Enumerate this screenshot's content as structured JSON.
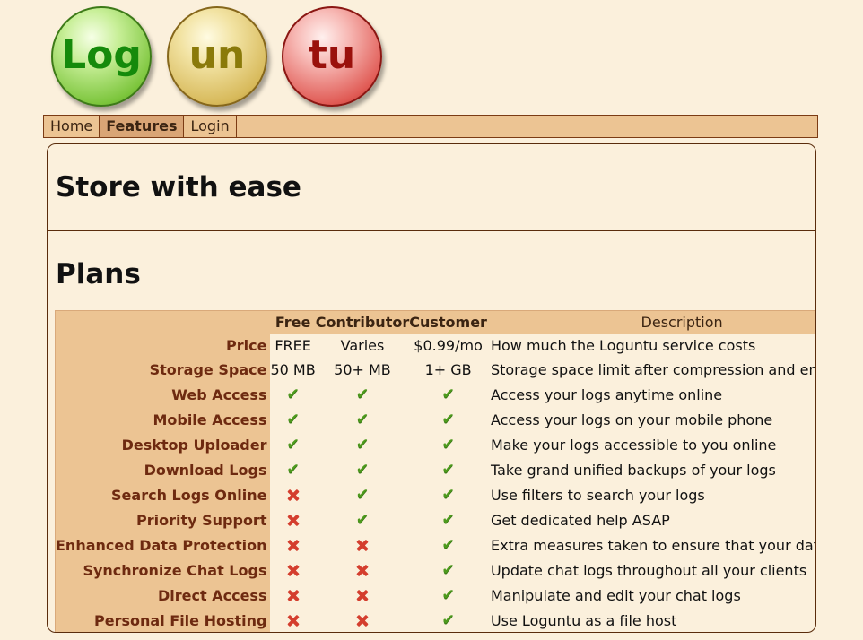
{
  "logo": [
    "Log",
    "un",
    "tu"
  ],
  "nav": [
    {
      "label": "Home",
      "active": false
    },
    {
      "label": "Features",
      "active": true
    },
    {
      "label": "Login",
      "active": false
    }
  ],
  "headings": {
    "store": "Store with ease",
    "plans": "Plans"
  },
  "table": {
    "headers": [
      "Free",
      "Contributor",
      "Customer",
      "Description"
    ],
    "rows": [
      {
        "feature": "Price",
        "free": "FREE",
        "contributor": "Varies",
        "customer": "$0.99/mo",
        "description": "How much the Loguntu service costs"
      },
      {
        "feature": "Storage Space",
        "free": "50 MB",
        "contributor": "50+ MB",
        "customer": "1+ GB",
        "description": "Storage space limit after compression and encryption"
      },
      {
        "feature": "Web Access",
        "free": "check",
        "contributor": "check",
        "customer": "check",
        "description": "Access your logs anytime online"
      },
      {
        "feature": "Mobile Access",
        "free": "check",
        "contributor": "check",
        "customer": "check",
        "description": "Access your logs on your mobile phone"
      },
      {
        "feature": "Desktop Uploader",
        "free": "check",
        "contributor": "check",
        "customer": "check",
        "description": "Make your logs accessible to you online"
      },
      {
        "feature": "Download Logs",
        "free": "check",
        "contributor": "check",
        "customer": "check",
        "description": "Take grand unified backups of your logs"
      },
      {
        "feature": "Search Logs Online",
        "free": "cross",
        "contributor": "check",
        "customer": "check",
        "description": "Use filters to search your logs"
      },
      {
        "feature": "Priority Support",
        "free": "cross",
        "contributor": "check",
        "customer": "check",
        "description": "Get dedicated help ASAP"
      },
      {
        "feature": "Enhanced Data Protection",
        "free": "cross",
        "contributor": "cross",
        "customer": "check",
        "description": "Extra measures taken to ensure that your data's safe"
      },
      {
        "feature": "Synchronize Chat Logs",
        "free": "cross",
        "contributor": "cross",
        "customer": "check",
        "description": "Update chat logs throughout all your clients"
      },
      {
        "feature": "Direct Access",
        "free": "cross",
        "contributor": "cross",
        "customer": "check",
        "description": "Manipulate and edit your chat logs"
      },
      {
        "feature": "Personal File Hosting",
        "free": "cross",
        "contributor": "cross",
        "customer": "check",
        "description": "Use Loguntu as a file host"
      }
    ]
  },
  "colors": {
    "page_bg": "#fbf0dc",
    "accent_bg": "#ecc493",
    "feature_text": "#6e2a10",
    "check": "#4d9a1d",
    "cross": "#d43e2e"
  }
}
